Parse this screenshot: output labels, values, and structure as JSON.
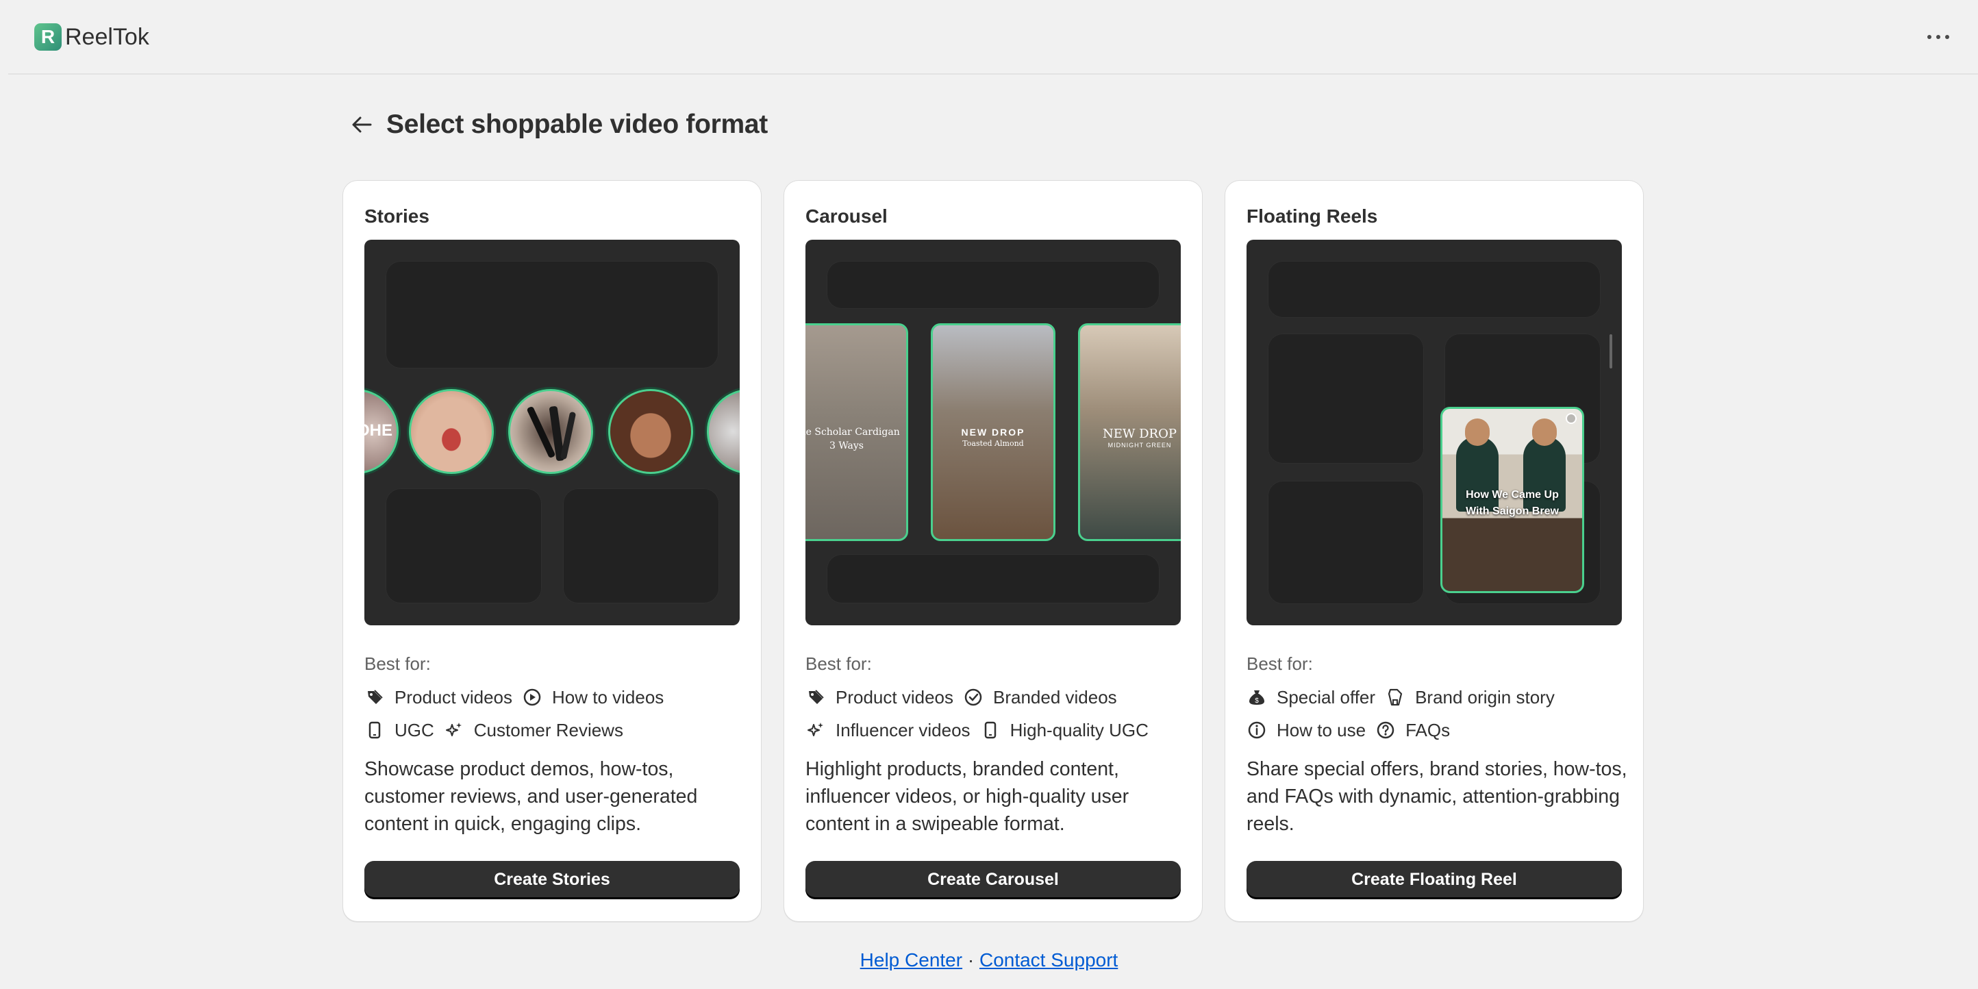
{
  "app": {
    "name": "ReelTok",
    "logo_letter": "R"
  },
  "page": {
    "title": "Select shoppable video format"
  },
  "colors": {
    "accent": "#4ad08e",
    "button": "#303030",
    "link": "#005bd3"
  },
  "cards": [
    {
      "title": "Stories",
      "best_for_label": "Best for:",
      "tags": [
        {
          "label": "Product videos",
          "icon": "tag-icon"
        },
        {
          "label": "How to videos",
          "icon": "play-circle-icon"
        },
        {
          "label": "UGC",
          "icon": "mobile-icon"
        },
        {
          "label": "Customer Reviews",
          "icon": "sparkle-icon"
        }
      ],
      "description": "Showcase product demos, how-tos, customer reviews, and user-generated content in quick, engaging clips.",
      "button": "Create Stories",
      "preview_text": "OHE"
    },
    {
      "title": "Carousel",
      "best_for_label": "Best for:",
      "tags": [
        {
          "label": "Product videos",
          "icon": "tag-icon"
        },
        {
          "label": "Branded videos",
          "icon": "check-circle-icon"
        },
        {
          "label": "Influencer videos",
          "icon": "sparkle-icon"
        },
        {
          "label": "High-quality UGC",
          "icon": "mobile-icon"
        }
      ],
      "description": "Highlight products, branded content, influencer videos, or high-quality user content in a swipeable format.",
      "button": "Create Carousel",
      "tiles": [
        {
          "line1": "The Scholar Cardigan",
          "line2": "3 Ways"
        },
        {
          "line1": "NEW DROP",
          "line2": "Toasted Almond"
        },
        {
          "line1": "NEW DROP",
          "line2": "MIDNIGHT GREEN"
        }
      ]
    },
    {
      "title": "Floating Reels",
      "best_for_label": "Best for:",
      "tags": [
        {
          "label": "Special offer",
          "icon": "money-bag-icon"
        },
        {
          "label": "Brand origin story",
          "icon": "store-icon"
        },
        {
          "label": "How to use",
          "icon": "info-icon"
        },
        {
          "label": "FAQs",
          "icon": "question-icon"
        }
      ],
      "description": "Share special offers, brand stories, how-tos, and FAQs with dynamic, attention-grabbing reels.",
      "button": "Create Floating Reel",
      "reel_caption_1": "How We Came Up",
      "reel_caption_2": "With Saigon Brew"
    }
  ],
  "footer": {
    "help": "Help Center",
    "separator": "·",
    "contact": "Contact Support"
  }
}
